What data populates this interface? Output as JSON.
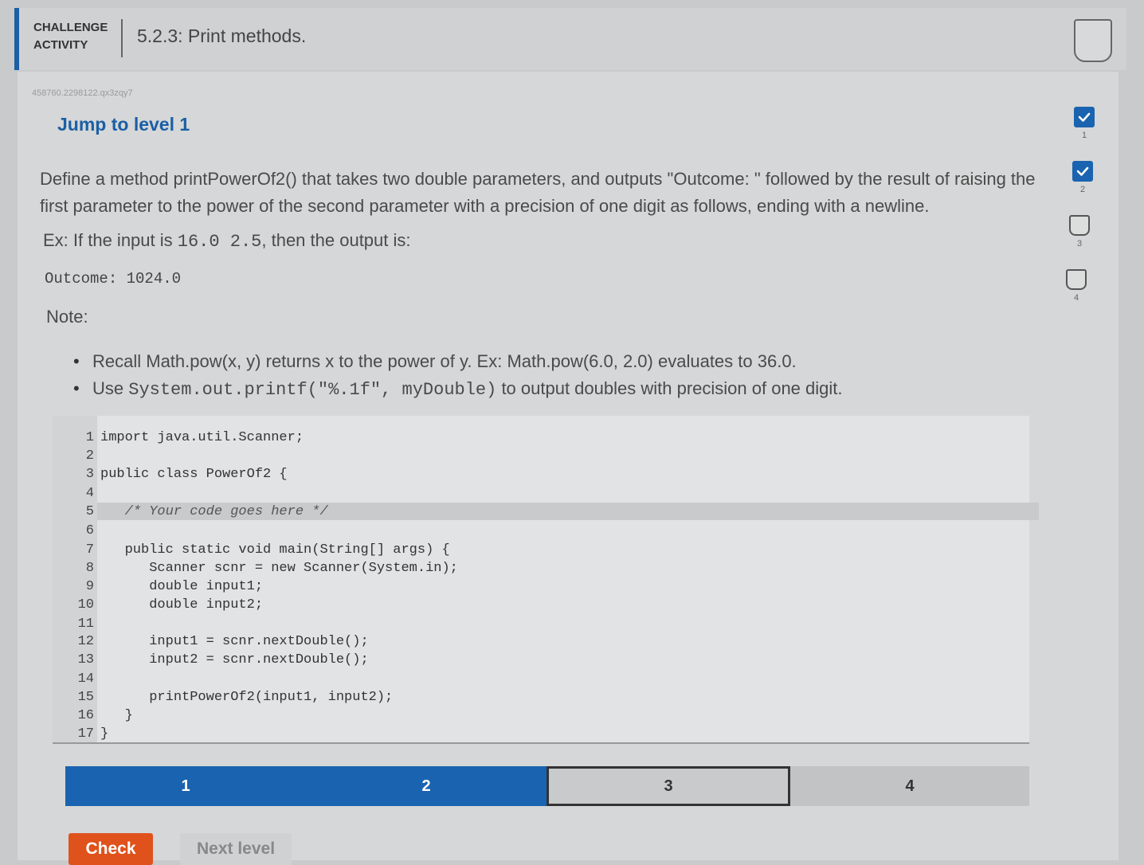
{
  "header": {
    "label_line1": "CHALLENGE",
    "label_line2": "ACTIVITY",
    "title": "5.2.3: Print methods."
  },
  "activity_id": "458760.2298122.qx3zqy7",
  "jump_label": "Jump to level 1",
  "description": {
    "text": "Define a method printPowerOf2() that takes two double parameters, and outputs \"Outcome: \" followed by the result of raising the first parameter to the power of the second parameter with a precision of one digit as follows, ending with a newline."
  },
  "example": {
    "prefix": "Ex: If the input is ",
    "input": "16.0 2.5",
    "suffix": ", then the output is:"
  },
  "outcome": "Outcome: 1024.0",
  "note_label": "Note:",
  "bullets": {
    "b1": "Recall Math.pow(x, y) returns x to the power of y. Ex: Math.pow(6.0, 2.0) evaluates to 36.0.",
    "b2_prefix": "Use ",
    "b2_code": "System.out.printf(\"%.1f\", myDouble)",
    "b2_suffix": " to output doubles with precision of one digit."
  },
  "code": {
    "lines": [
      {
        "n": "1",
        "text": "import java.util.Scanner;"
      },
      {
        "n": "2",
        "text": ""
      },
      {
        "n": "3",
        "text": "public class PowerOf2 {"
      },
      {
        "n": "4",
        "text": ""
      },
      {
        "n": "5",
        "text": "   /* Your code goes here */"
      },
      {
        "n": "6",
        "text": ""
      },
      {
        "n": "7",
        "text": "   public static void main(String[] args) {"
      },
      {
        "n": "8",
        "text": "      Scanner scnr = new Scanner(System.in);"
      },
      {
        "n": "9",
        "text": "      double input1;"
      },
      {
        "n": "10",
        "text": "      double input2;"
      },
      {
        "n": "11",
        "text": ""
      },
      {
        "n": "12",
        "text": "      input1 = scnr.nextDouble();"
      },
      {
        "n": "13",
        "text": "      input2 = scnr.nextDouble();"
      },
      {
        "n": "14",
        "text": ""
      },
      {
        "n": "15",
        "text": "      printPowerOf2(input1, input2);"
      },
      {
        "n": "16",
        "text": "   }"
      },
      {
        "n": "17",
        "text": "}"
      }
    ]
  },
  "levels": [
    {
      "label": "1",
      "state": "done"
    },
    {
      "label": "2",
      "state": "done"
    },
    {
      "label": "3",
      "state": "current"
    },
    {
      "label": "4",
      "state": "todo"
    }
  ],
  "buttons": {
    "check": "Check",
    "next": "Next level"
  },
  "side_progress": [
    {
      "label": "1",
      "completed": true
    },
    {
      "label": "2",
      "completed": true
    },
    {
      "label": "3",
      "completed": false
    },
    {
      "label": "4",
      "completed": false
    }
  ],
  "colors": {
    "accent": "#1b5fa5",
    "check_button": "#e0521b"
  }
}
